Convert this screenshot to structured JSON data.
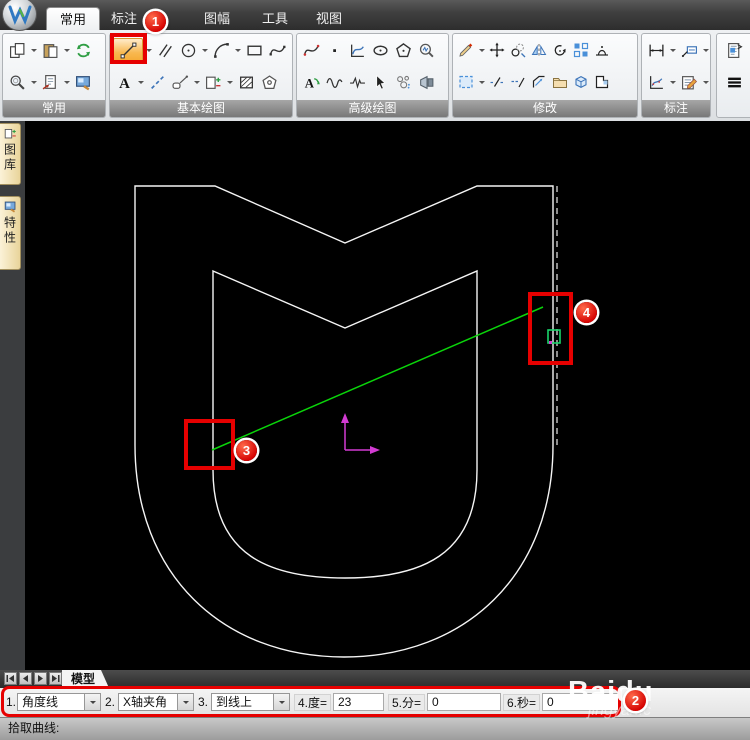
{
  "titlebar": {
    "tabs": [
      {
        "label": "常用",
        "active": true
      },
      {
        "label": "标注",
        "active": false
      },
      {
        "label": "图幅",
        "active": false
      },
      {
        "label": "工具",
        "active": false
      },
      {
        "label": "视图",
        "active": false
      }
    ]
  },
  "ribbon": {
    "groups": [
      {
        "label": "常用"
      },
      {
        "label": "基本绘图"
      },
      {
        "label": "高级绘图"
      },
      {
        "label": "修改"
      },
      {
        "label": "标注"
      }
    ],
    "highlighted_tool": "line-tool"
  },
  "sidebar": {
    "tabs": [
      {
        "label": "图库"
      },
      {
        "label": "特性"
      }
    ]
  },
  "canvas": {
    "background": "#000000",
    "shape_color": "#f5f5f5",
    "construction_line_color": "#0ad40a",
    "ucs_color": "#d23bd2",
    "snap_marker_color": "#19d46a"
  },
  "bottombar": {
    "model_tab": "模型"
  },
  "option_bar": {
    "fields": [
      {
        "label": "1.",
        "value": "角度线",
        "type": "dropdown"
      },
      {
        "label": "2.",
        "value": "X轴夹角",
        "type": "dropdown"
      },
      {
        "label": "3.",
        "value": "到线上",
        "type": "dropdown"
      },
      {
        "label": "4.度=",
        "value": "23",
        "type": "input"
      },
      {
        "label": "5.分=",
        "value": "0",
        "type": "input"
      },
      {
        "label": "6.秒=",
        "value": "0",
        "type": "input"
      }
    ]
  },
  "statusbar": {
    "prompt": "拾取曲线:"
  },
  "annotations": {
    "steps": [
      "1",
      "2",
      "3",
      "4"
    ],
    "color": "#e60000"
  },
  "watermark": {
    "line1": "Baidu",
    "line2": "jingyan.c"
  }
}
